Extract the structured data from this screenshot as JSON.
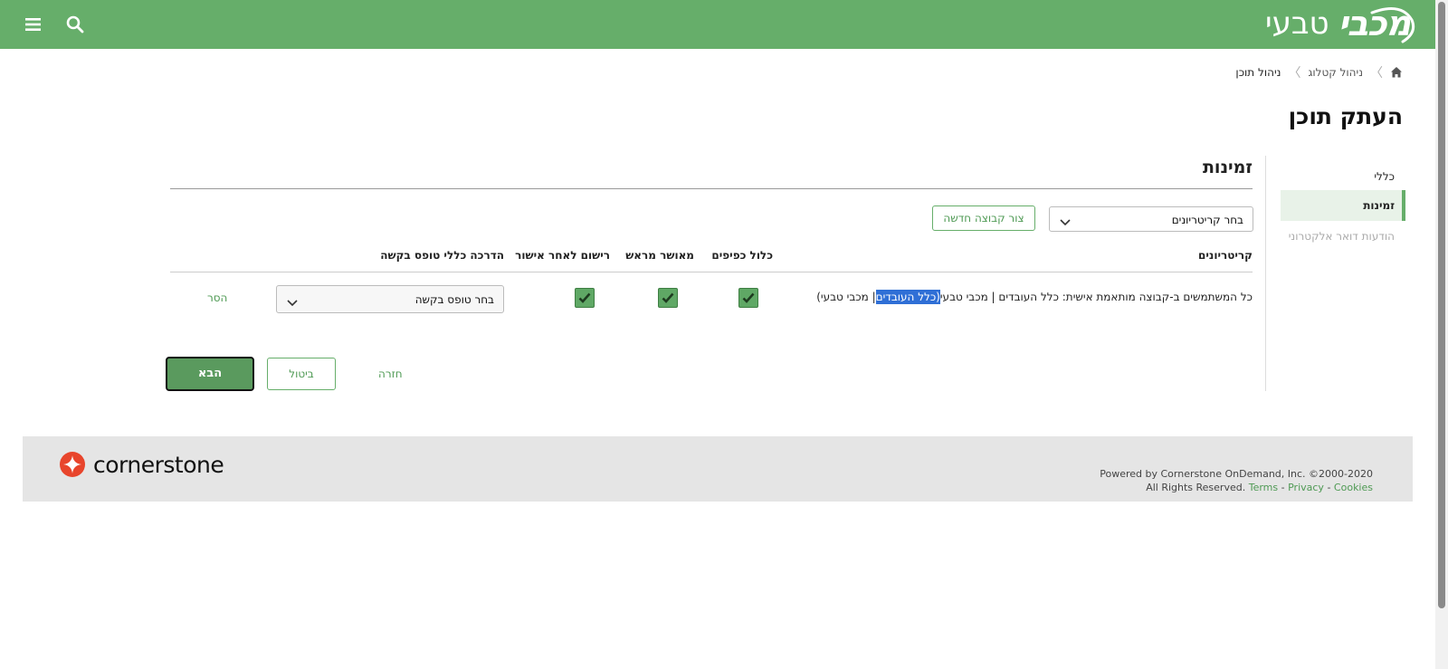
{
  "header": {
    "logo_main": "מכבי",
    "logo_sub": "טבעי",
    "menu_icon": "hamburger-menu-icon",
    "search_icon": "search-icon",
    "bg_color": "#66ae6a"
  },
  "breadcrumb": {
    "home_icon": "home-icon",
    "items": [
      "ניהול קטלוג",
      "ניהול תוכן"
    ]
  },
  "page_title": "העתק תוכן",
  "sidenav": {
    "items": [
      "כללי",
      "זמינות",
      "הודעות דואר אלקטרוני"
    ],
    "active_index": 1
  },
  "section": {
    "title": "זמינות",
    "criteria_select": "בחר קריטריונים",
    "new_group_button": "צור קבוצה חדשה"
  },
  "table": {
    "headers": {
      "criteria": "קריטריונים",
      "include_subordinates": "כלול כפיפים",
      "pre_approved": "מאושר מראש",
      "register_after_approval": "רישום לאחר אישור",
      "request_form_guide": "הדרכה כללי טופס בקשה"
    },
    "rows": [
      {
        "criteria_prefix": "כל המשתמשים ב-קבוצה מותאמת אישית: כלל העובדים | מכבי טבעי",
        "criteria_highlight": "(כלל העובדים",
        "criteria_suffix": "| מכבי טבעי)",
        "include_subordinates": true,
        "pre_approved": true,
        "register_after_approval": true,
        "request_form_select": "בחר טופס בקשה",
        "remove_label": "הסר"
      }
    ]
  },
  "actions": {
    "back": "חזרה",
    "cancel": "ביטול",
    "next": "הבא"
  },
  "footer": {
    "brand": "cornerstone",
    "legal_line1": "Powered by Cornerstone OnDemand, Inc. ©2000-2020",
    "legal_line2_prefix": "All Rights Reserved.",
    "terms": "Terms",
    "privacy": "Privacy",
    "cookies": "Cookies",
    "sep": "-"
  },
  "colors": {
    "accent": "#66ae6a",
    "link": "#4f9a54",
    "highlight": "#2f6fd6",
    "brand_mark": "#e8452c"
  }
}
